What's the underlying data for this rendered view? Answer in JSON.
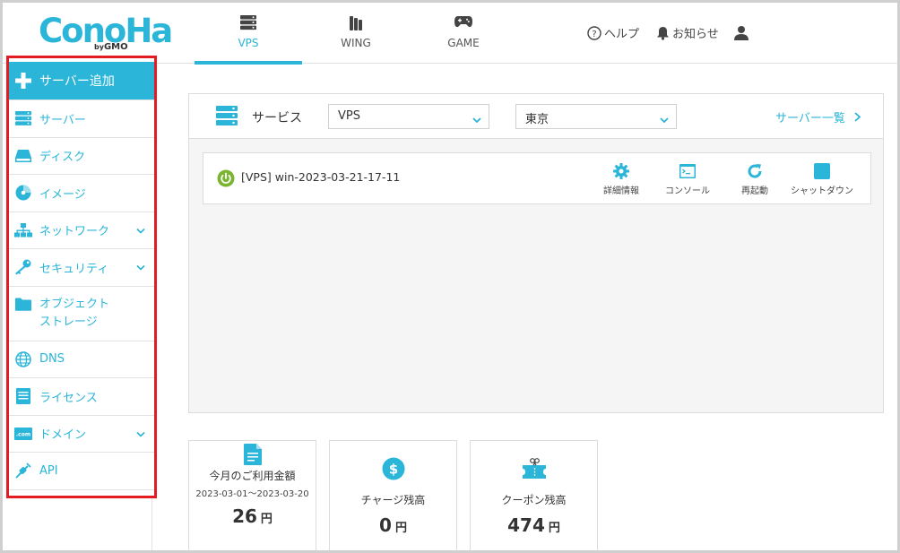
{
  "colors": {
    "accent": "#2bb5d8",
    "highlight_border": "#e31c24",
    "power_on": "#7ab531"
  },
  "header": {
    "logo_text": "ConoHa",
    "logo_by": "by",
    "logo_brand": "GMO",
    "tabs": [
      {
        "label": "VPS",
        "icon": "server-icon",
        "active": true
      },
      {
        "label": "WING",
        "icon": "wing-icon",
        "active": false
      },
      {
        "label": "GAME",
        "icon": "gamepad-icon",
        "active": false
      }
    ],
    "help_label": "ヘルプ",
    "notice_label": "お知らせ"
  },
  "sidebar": {
    "items": [
      {
        "label": "サーバー追加",
        "icon": "plus-icon"
      },
      {
        "label": "サーバー",
        "icon": "server-icon"
      },
      {
        "label": "ディスク",
        "icon": "disk-icon"
      },
      {
        "label": "イメージ",
        "icon": "image-disc-icon"
      },
      {
        "label": "ネットワーク",
        "icon": "network-icon",
        "expandable": true
      },
      {
        "label": "セキュリティ",
        "icon": "key-icon",
        "expandable": true
      },
      {
        "label_line1": "オブジェクト",
        "label_line2": "ストレージ",
        "icon": "folder-icon"
      },
      {
        "label": "DNS",
        "icon": "globe-icon"
      },
      {
        "label": "ライセンス",
        "icon": "license-icon"
      },
      {
        "label": "ドメイン",
        "icon": "domain-icon",
        "expandable": true
      },
      {
        "label": "API",
        "icon": "api-plug-icon"
      }
    ]
  },
  "main": {
    "service_label": "サービス",
    "service_select": "VPS",
    "region_select": "東京",
    "server_list_link": "サーバー一覧",
    "server": {
      "name": "[VPS] win-2023-03-21-17-11",
      "status": "on",
      "actions": [
        {
          "label": "詳細情報",
          "icon": "gear-icon"
        },
        {
          "label": "コンソール",
          "icon": "console-icon"
        },
        {
          "label": "再起動",
          "icon": "restart-icon"
        },
        {
          "label": "シャットダウン",
          "icon": "stop-icon"
        }
      ]
    }
  },
  "billing": {
    "monthly": {
      "title": "今月のご利用金額",
      "period": "2023-03-01～2023-03-20",
      "value": "26",
      "unit": "円"
    },
    "charge": {
      "title": "チャージ残高",
      "value": "0",
      "unit": "円"
    },
    "coupon": {
      "title": "クーポン残高",
      "value": "474",
      "unit": "円"
    }
  }
}
